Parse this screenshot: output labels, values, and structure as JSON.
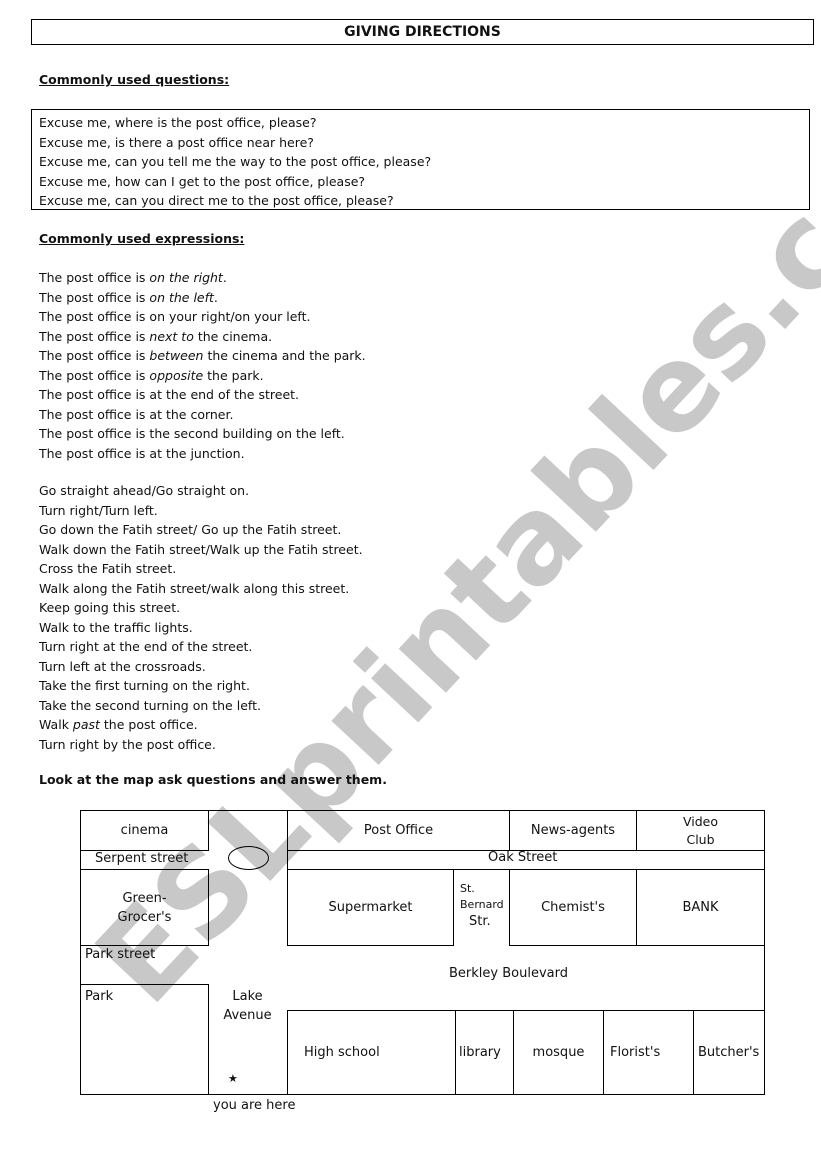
{
  "title": "GIVING DIRECTIONS",
  "questions_section": {
    "heading": "Commonly used questions:",
    "items": [
      "Excuse me, where is the post office, please?",
      "Excuse me, is there a post office near here?",
      "Excuse me, can you tell me the way to the post office, please?",
      "Excuse me, how can I get to the post office, please?",
      "Excuse me, can you direct me to the post office, please?"
    ]
  },
  "expressions_section": {
    "heading": "Commonly used expressions:",
    "locations": [
      {
        "pre": "The post office is ",
        "em": "on the right",
        "post": "."
      },
      {
        "pre": "The post office is ",
        "em": "on the left",
        "post": "."
      },
      {
        "pre": "The post office is on your right/on your left.",
        "em": "",
        "post": ""
      },
      {
        "pre": "The post office is ",
        "em": "next to",
        "post": " the cinema."
      },
      {
        "pre": "The post office is ",
        "em": "between",
        "post": " the cinema and the park."
      },
      {
        "pre": "The post office is ",
        "em": "opposite",
        "post": " the park."
      },
      {
        "pre": "The post office is at the end of the street.",
        "em": "",
        "post": ""
      },
      {
        "pre": "The post office is at the corner.",
        "em": "",
        "post": ""
      },
      {
        "pre": "The post office is the second building on the left.",
        "em": "",
        "post": ""
      },
      {
        "pre": "The post office is at the junction.",
        "em": "",
        "post": ""
      }
    ],
    "directions": [
      {
        "pre": "Go straight ahead/Go straight on.",
        "em": "",
        "post": ""
      },
      {
        "pre": "Turn right/Turn left.",
        "em": "",
        "post": ""
      },
      {
        "pre": "Go down the Fatih street/ Go up the Fatih street.",
        "em": "",
        "post": ""
      },
      {
        "pre": "Walk down the Fatih street/Walk up the Fatih street.",
        "em": "",
        "post": ""
      },
      {
        "pre": "Cross the Fatih street.",
        "em": "",
        "post": ""
      },
      {
        "pre": "Walk along the Fatih street/walk along this street.",
        "em": "",
        "post": ""
      },
      {
        "pre": "Keep going this street.",
        "em": "",
        "post": ""
      },
      {
        "pre": "Walk to the traffic lights.",
        "em": "",
        "post": ""
      },
      {
        "pre": "Turn right at the end of the street.",
        "em": "",
        "post": ""
      },
      {
        "pre": "Turn left at the crossroads.",
        "em": "",
        "post": ""
      },
      {
        "pre": "Take the first turning on the right.",
        "em": "",
        "post": ""
      },
      {
        "pre": "Take the second turning on the left.",
        "em": "",
        "post": ""
      },
      {
        "pre": "Walk ",
        "em": "past",
        "post": " the post office."
      },
      {
        "pre": "Turn right by the post office.",
        "em": "",
        "post": ""
      }
    ]
  },
  "instruction": "Look at the map ask questions and answer them.",
  "map": {
    "buildings": {
      "cinema": "cinema",
      "green_grocers": "Green-\nGrocer's",
      "park": "Park",
      "post_office": "Post Office",
      "news_agents": "News-agents",
      "video_club": "Video\nClub",
      "supermarket": "Supermarket",
      "chemists": "Chemist's",
      "bank": "BANK",
      "high_school": "High school",
      "library": "library",
      "mosque": "mosque",
      "florists": "Florist's",
      "butchers": "Butcher's"
    },
    "streets": {
      "serpent": "Serpent street",
      "park": "Park street",
      "lake_avenue": "Lake\nAvenue",
      "oak": "Oak Street",
      "st_bernard": "St.\nBernard",
      "st_bernard_suffix": "Str.",
      "berkley": "Berkley Boulevard"
    },
    "marker_symbol": "★",
    "you_are_here": "you are here"
  },
  "watermark": "ESLprintables.com",
  "colors": {
    "watermark": "#c8c8c8",
    "ink": "#000000"
  }
}
